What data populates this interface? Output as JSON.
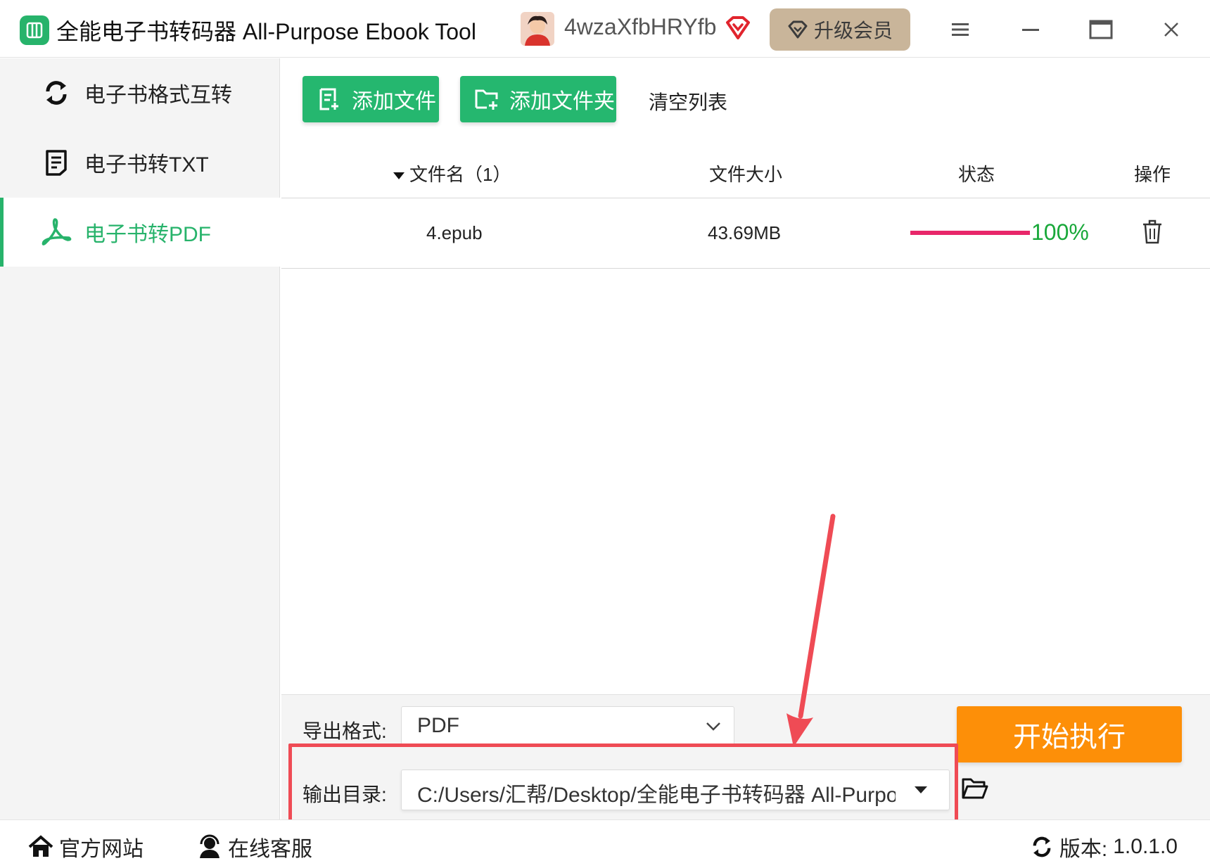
{
  "titlebar": {
    "app_title": "全能电子书转码器 All-Purpose Ebook Tool",
    "username": "4wzaXfbHRYfb",
    "upgrade_label": "升级会员"
  },
  "sidebar": {
    "items": [
      {
        "label": "电子书格式互转",
        "icon": "refresh-icon",
        "active": false
      },
      {
        "label": "电子书转TXT",
        "icon": "document-icon",
        "active": false
      },
      {
        "label": "电子书转PDF",
        "icon": "pdf-icon",
        "active": true
      }
    ]
  },
  "toolbar": {
    "add_file_label": "添加文件",
    "add_folder_label": "添加文件夹",
    "clear_label": "清空列表"
  },
  "table": {
    "headers": {
      "filename": "文件名（1）",
      "size": "文件大小",
      "status": "状态",
      "action": "操作"
    },
    "rows": [
      {
        "filename": "4.epub",
        "size": "43.69MB",
        "progress": 1.0,
        "progress_text": "100%"
      }
    ]
  },
  "config": {
    "format_label": "导出格式:",
    "format_value": "PDF",
    "output_label": "输出目录:",
    "output_value": "C:/Users/汇帮/Desktop/全能电子书转码器 All-Purpo:",
    "start_label": "开始执行"
  },
  "footer": {
    "website_label": "官方网站",
    "support_label": "在线客服",
    "version_label": "版本:",
    "version_value": "1.0.1.0"
  },
  "colors": {
    "accent_green": "#25b76f",
    "start_orange": "#fd8f08",
    "progress_pink": "#e8276a",
    "progress_text_green": "#19a83a",
    "highlight_red": "#ef4b55",
    "upgrade_bg": "#c9b59a"
  }
}
